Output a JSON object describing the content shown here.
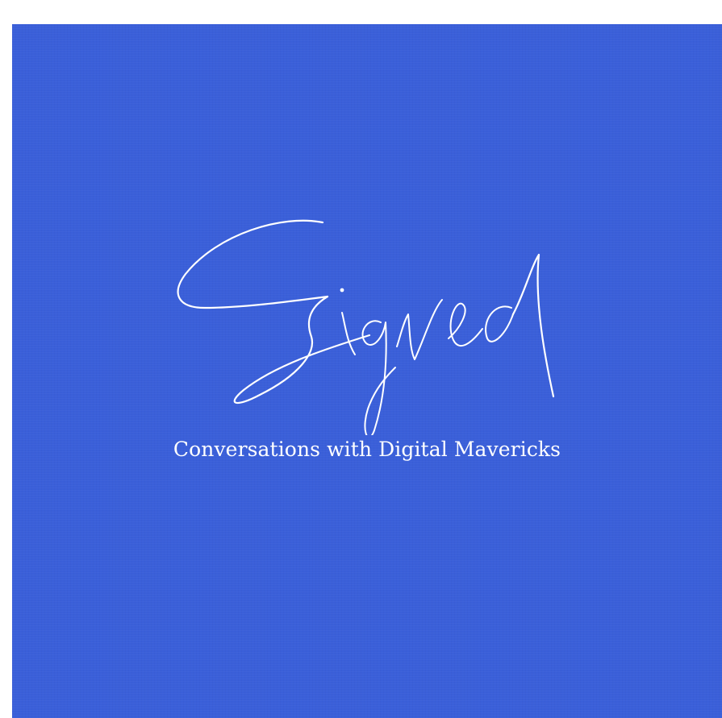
{
  "cover": {
    "background_color": "#3a5fd9",
    "text_color": "#ffffff",
    "logo_word": "Signed",
    "subtitle": "Conversations with Digital Mavericks"
  }
}
